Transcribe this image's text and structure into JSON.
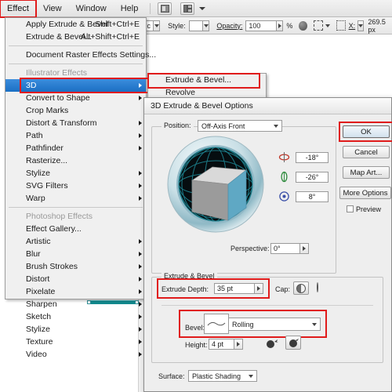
{
  "menubar": {
    "items": [
      {
        "label": "Effect",
        "selected": true
      },
      {
        "label": "View",
        "selected": false
      },
      {
        "label": "Window",
        "selected": false
      },
      {
        "label": "Help",
        "selected": false
      }
    ],
    "icon_bridge": "bridge-icon",
    "icon_arrange": "arrange-documents-icon",
    "icon_caret": "chevron-down-icon"
  },
  "controlbar": {
    "profile_value": "asic",
    "style_label": "Style:",
    "opacity_label": "Opacity:",
    "opacity_value": "100",
    "percent": "%",
    "transparency_icon": "opacity-icon",
    "align_icon": "align-icon",
    "transform_icon": "transform-icon",
    "x_label": "X:",
    "x_value": "269.5 px"
  },
  "effect_menu": {
    "items": [
      {
        "label": "Apply Extrude & Bevel",
        "shortcut": "Shift+Ctrl+E",
        "arrow": false,
        "header": false,
        "highlight": false
      },
      {
        "label": "Extrude & Bevel...",
        "shortcut": "Alt+Shift+Ctrl+E",
        "arrow": false,
        "header": false,
        "highlight": false
      },
      {
        "sep": true
      },
      {
        "label": "Document Raster Effects Settings...",
        "shortcut": "",
        "arrow": false,
        "header": false,
        "highlight": false
      },
      {
        "sep": true
      },
      {
        "label": "Illustrator Effects",
        "shortcut": "",
        "arrow": false,
        "header": true,
        "highlight": false
      },
      {
        "label": "3D",
        "shortcut": "",
        "arrow": true,
        "header": false,
        "highlight": true
      },
      {
        "label": "Convert to Shape",
        "shortcut": "",
        "arrow": true,
        "header": false,
        "highlight": false
      },
      {
        "label": "Crop Marks",
        "shortcut": "",
        "arrow": false,
        "header": false,
        "highlight": false
      },
      {
        "label": "Distort & Transform",
        "shortcut": "",
        "arrow": true,
        "header": false,
        "highlight": false
      },
      {
        "label": "Path",
        "shortcut": "",
        "arrow": true,
        "header": false,
        "highlight": false
      },
      {
        "label": "Pathfinder",
        "shortcut": "",
        "arrow": true,
        "header": false,
        "highlight": false
      },
      {
        "label": "Rasterize...",
        "shortcut": "",
        "arrow": false,
        "header": false,
        "highlight": false
      },
      {
        "label": "Stylize",
        "shortcut": "",
        "arrow": true,
        "header": false,
        "highlight": false
      },
      {
        "label": "SVG Filters",
        "shortcut": "",
        "arrow": true,
        "header": false,
        "highlight": false
      },
      {
        "label": "Warp",
        "shortcut": "",
        "arrow": true,
        "header": false,
        "highlight": false
      },
      {
        "sep": true
      },
      {
        "label": "Photoshop Effects",
        "shortcut": "",
        "arrow": false,
        "header": true,
        "highlight": false
      },
      {
        "label": "Effect Gallery...",
        "shortcut": "",
        "arrow": false,
        "header": false,
        "highlight": false
      },
      {
        "label": "Artistic",
        "shortcut": "",
        "arrow": true,
        "header": false,
        "highlight": false
      },
      {
        "label": "Blur",
        "shortcut": "",
        "arrow": true,
        "header": false,
        "highlight": false
      },
      {
        "label": "Brush Strokes",
        "shortcut": "",
        "arrow": true,
        "header": false,
        "highlight": false
      },
      {
        "label": "Distort",
        "shortcut": "",
        "arrow": true,
        "header": false,
        "highlight": false
      },
      {
        "label": "Pixelate",
        "shortcut": "",
        "arrow": true,
        "header": false,
        "highlight": false
      },
      {
        "label": "Sharpen",
        "shortcut": "",
        "arrow": true,
        "header": false,
        "highlight": false
      },
      {
        "label": "Sketch",
        "shortcut": "",
        "arrow": true,
        "header": false,
        "highlight": false
      },
      {
        "label": "Stylize",
        "shortcut": "",
        "arrow": true,
        "header": false,
        "highlight": false
      },
      {
        "label": "Texture",
        "shortcut": "",
        "arrow": true,
        "header": false,
        "highlight": false
      },
      {
        "label": "Video",
        "shortcut": "",
        "arrow": true,
        "header": false,
        "highlight": false
      }
    ]
  },
  "submenu": {
    "items": [
      {
        "label": "Extrude & Bevel...",
        "highlighted_box": true
      },
      {
        "label": "Revolve",
        "highlighted_box": false
      }
    ]
  },
  "dialog": {
    "title": "3D Extrude & Bevel Options",
    "position_group_label": "Position:",
    "position_value": "Off-Axis Front",
    "rotation": {
      "x_icon": "rotate-x-icon",
      "x_value": "-18°",
      "y_icon": "rotate-y-icon",
      "y_value": "-26°",
      "z_icon": "rotate-z-icon",
      "z_value": "8°"
    },
    "perspective_label": "Perspective:",
    "perspective_value": "0°",
    "extrude_group_label": "Extrude & Bevel",
    "extrude_depth_label": "Extrude Depth:",
    "extrude_depth_value": "35 pt",
    "cap_label": "Cap:",
    "cap_on_icon": "cap-solid-icon",
    "cap_off_icon": "cap-hollow-icon",
    "bevel_label": "Bevel:",
    "bevel_value": "Rolling",
    "bevel_preview_icon": "rolling-bevel-icon",
    "height_label": "Height:",
    "height_value": "4 pt",
    "bevel_out_icon": "bevel-extent-out-icon",
    "bevel_in_icon": "bevel-extent-in-icon",
    "surface_label": "Surface:",
    "surface_value": "Plastic Shading",
    "buttons": {
      "ok": "OK",
      "cancel": "Cancel",
      "map_art": "Map Art...",
      "more_options": "More Options",
      "preview": "Preview"
    }
  },
  "colors": {
    "highlight_box": "#e01b1b",
    "menu_highlight": "#1a6fc4",
    "cube_front": "#5fa8c4",
    "cube_left": "#9b9b9b",
    "cube_top": "#d9d9d9",
    "artwork_teal": "#128a8f",
    "sphere_dark": "#060d10"
  },
  "artwork": {
    "shape_name": "selected-teal-rectangle",
    "anchor_icon": "anchor-point-icon"
  }
}
